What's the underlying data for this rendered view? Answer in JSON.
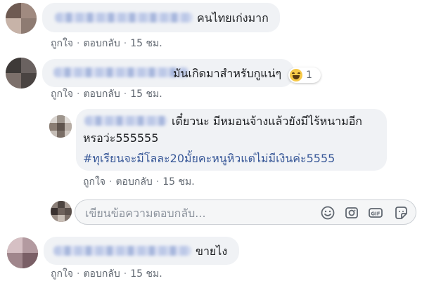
{
  "comments": [
    {
      "text": "คนไทยเก่งมาก",
      "actions": {
        "like": "ถูกใจ",
        "reply": "ตอบกลับ",
        "time": "15 ชม."
      }
    },
    {
      "text": "มันเกิดมาสำหรับกูแน่ๆ",
      "reaction": {
        "emoji": "laughing-emoji",
        "count": "1"
      },
      "actions": {
        "like": "ถูกใจ",
        "reply": "ตอบกลับ",
        "time": "15 ชม."
      }
    },
    {
      "text_line1": "เดี๋ยวนะ มีหมอนจ้างแล้วยังมีไร้หนามอีก",
      "text_line2": "หรอว่ะ555555",
      "hashtag": "#ทุเรียนจะมีโลละ20มั้ยคะหนูหิวแต่ไม่มีเงินค่ะ5555",
      "actions": {
        "like": "ถูกใจ",
        "reply": "ตอบกลับ",
        "time": "15 ชม."
      }
    },
    {
      "text": "ขายไง",
      "actions": {
        "like": "ถูกใจ",
        "reply": "ตอบกลับ",
        "time": "15 ชม."
      }
    }
  ],
  "reply_box": {
    "placeholder": "เขียนข้อความตอบกลับ...",
    "icons": [
      "emoji-icon",
      "camera-icon",
      "gif-icon",
      "sticker-icon"
    ]
  },
  "colors": {
    "bubble": "#f0f2f5",
    "action_text": "#606770",
    "hashtag": "#385898"
  }
}
